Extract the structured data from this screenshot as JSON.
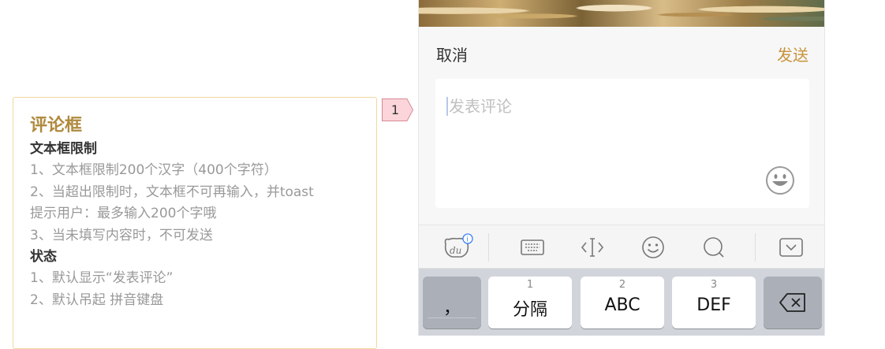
{
  "annotation": {
    "title": "评论框",
    "sections": [
      {
        "heading": "文本框限制",
        "lines": [
          "1、文本框限制200个汉字（400个字符）",
          "2、当超出限制时，文本框不可再输入，并toast",
          "提示用户：最多输入200个字哦",
          "3、当未填写内容时，不可发送"
        ]
      },
      {
        "heading": "状态",
        "lines": [
          "1、默认显示“发表评论”",
          "2、默认吊起 拼音键盘"
        ]
      }
    ]
  },
  "marker": {
    "number": "1"
  },
  "composer": {
    "cancel_label": "取消",
    "send_label": "发送",
    "placeholder": "发表评论",
    "emoji_icon": "smiley-face-icon"
  },
  "toolbar": {
    "icons": [
      "du-bear-icon",
      "keyboard-icon",
      "cursor-move-icon",
      "emoji-icon",
      "search-icon",
      "collapse-keyboard-icon"
    ]
  },
  "keyboard": {
    "punct_key": "，",
    "keys": [
      {
        "num": "1",
        "label": "分隔"
      },
      {
        "num": "2",
        "label": "ABC"
      },
      {
        "num": "3",
        "label": "DEF"
      }
    ],
    "delete_icon": "backspace-icon"
  },
  "colors": {
    "accent": "#c9933c",
    "annotation_title": "#b08a3e",
    "annotation_border": "#f0d8a0",
    "marker_fill": "#fbd5da"
  }
}
